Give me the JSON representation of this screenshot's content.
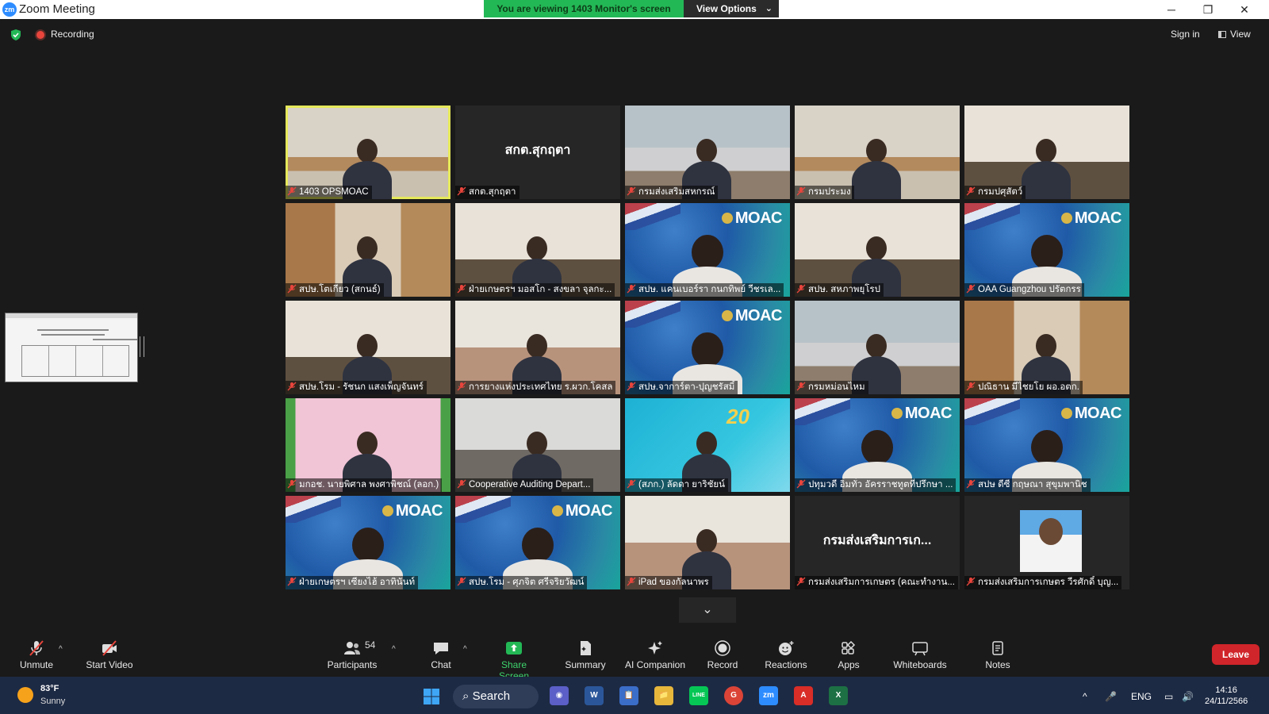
{
  "window": {
    "title": "Zoom Meeting",
    "logo_text": "zm",
    "viewing_banner": "You are viewing 1403  Monitor's screen",
    "view_options": "View Options",
    "controls": [
      "─",
      "❐",
      "✕"
    ]
  },
  "status": {
    "recording": "Recording",
    "sign_in": "Sign in",
    "view": "View"
  },
  "tiles": [
    {
      "name": "1403 OPSMOAC",
      "bg": "room",
      "active": true
    },
    {
      "name": "สกต.สุกฤตา",
      "bg": "blank",
      "center_name": "สกต.สุกฤตา"
    },
    {
      "name": "กรมส่งเสริมสหกรณ์",
      "bg": "room2"
    },
    {
      "name": "กรมประมง",
      "bg": "room"
    },
    {
      "name": "กรมปศุสัตว์",
      "bg": "office"
    },
    {
      "name": "สปษ.โตเกียว (สกนธ์)",
      "bg": "wood"
    },
    {
      "name": "ฝ่ายเกษตรฯ มอสโก - สงขลา จุลกะ...",
      "bg": "office"
    },
    {
      "name": "สปษ. แคนเบอร์รา กนกทิพย์ วีชรเล...",
      "bg": "moac"
    },
    {
      "name": "สปษ. สหภาพยุโรป",
      "bg": "office"
    },
    {
      "name": "OAA Guangzhou ปรัตกรร",
      "bg": "moac"
    },
    {
      "name": "สปษ.โรม - รัชนก แสงเพ็ญจันทร์",
      "bg": "office"
    },
    {
      "name": "การยางแห่งประเทศไทย ร.ผวก.โคสล",
      "bg": "face"
    },
    {
      "name": "สปษ.จาการ์ตา-ปุญชรัสมิ์",
      "bg": "moac"
    },
    {
      "name": "กรมหม่อนไหม",
      "bg": "room2"
    },
    {
      "name": "ปณิธาน มีไชยโย ผอ.อตก.",
      "bg": "wood"
    },
    {
      "name": "มกอช. นายพิศาล พงศาพิชณ์ (ลอก.)",
      "bg": "pink"
    },
    {
      "name": "Cooperative Auditing Depart...",
      "bg": "grey"
    },
    {
      "name": "(สภก.) ลัดดา ยาริชัยน์",
      "bg": "cyan",
      "badge": "20"
    },
    {
      "name": "ปทุมวดี อิ่มทั่ว อัครราชทูตที่ปรึกษา ...",
      "bg": "moac"
    },
    {
      "name": "สปษ ดีซี กฤษณา สุขุมพานิช",
      "bg": "moac"
    },
    {
      "name": "ฝ่ายเกษตรฯ เซียงไฮ้ อาทินันท์",
      "bg": "moac"
    },
    {
      "name": "สปษ.โรม - ศุภจิต ศรีจริยวัฒน์",
      "bg": "moac"
    },
    {
      "name": "iPad ของกัลนาพร",
      "bg": "face"
    },
    {
      "name": "กรมส่งเสริมการเกษตร (คณะทำงาน...",
      "bg": "blank",
      "center_name": "กรมส่งเสริมการเก..."
    },
    {
      "name": "กรมส่งเสริมการเกษตร วีรศักดิ์ บุญ...",
      "bg": "portrait"
    }
  ],
  "moac_logo": "MOAC",
  "more_icon": "⌄",
  "toolbar": {
    "unmute": "Unmute",
    "start_video": "Start Video",
    "participants": "Participants",
    "participants_count": "54",
    "chat": "Chat",
    "share_screen": "Share Screen",
    "summary": "Summary",
    "ai_companion": "AI Companion",
    "record": "Record",
    "reactions": "Reactions",
    "apps": "Apps",
    "whiteboards": "Whiteboards",
    "notes": "Notes",
    "leave": "Leave",
    "caret": "^"
  },
  "taskbar": {
    "temperature": "83°F",
    "condition": "Sunny",
    "search": "Search",
    "apps": [
      "W",
      "📋",
      "📁",
      "LINE",
      "G",
      "zm",
      "A",
      "X"
    ],
    "lang": "ENG",
    "time": "14:16",
    "date": "24/11/2566",
    "tray_caret": "^"
  },
  "colors": {
    "banner_green": "#23b856",
    "active_border": "#e5e85a",
    "leave_red": "#d0252a",
    "taskbar": "#1d2a44"
  }
}
